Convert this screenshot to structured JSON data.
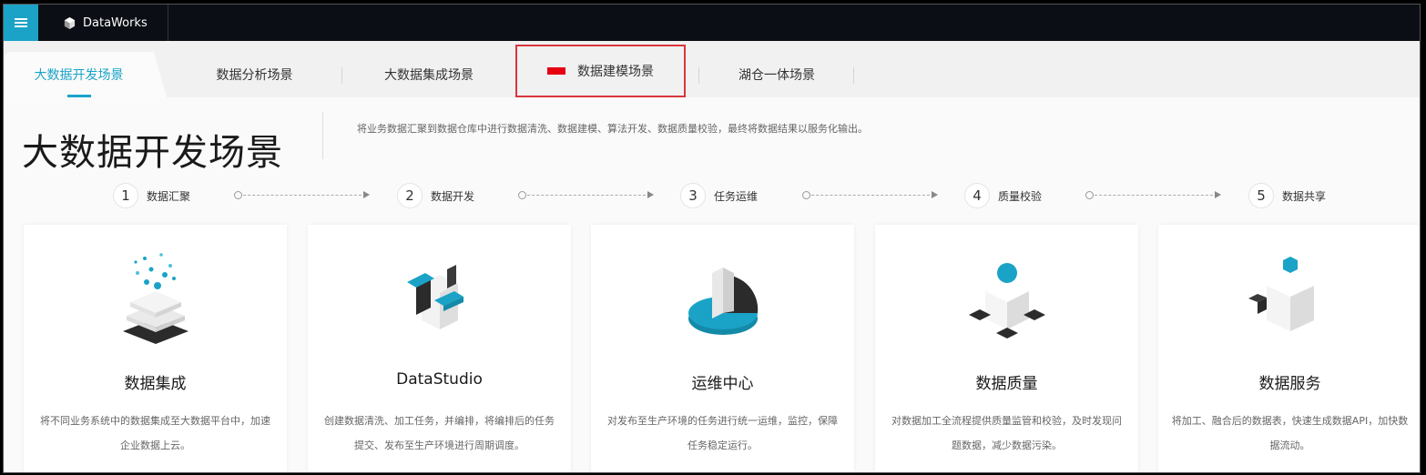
{
  "app": {
    "brand": "DataWorks"
  },
  "tabs": [
    {
      "label": "大数据开发场景",
      "active": true
    },
    {
      "label": "数据分析场景",
      "active": false
    },
    {
      "label": "大数据集成场景",
      "active": false
    },
    {
      "label": "数据建模场景",
      "active": false,
      "highlighted": true
    },
    {
      "label": "湖仓一体场景",
      "active": false
    }
  ],
  "hero": {
    "title": "大数据开发场景",
    "description": "将业务数据汇聚到数据仓库中进行数据清洗、数据建模、算法开发、数据质量校验，最终将数据结果以服务化输出。"
  },
  "steps": [
    {
      "num": "1",
      "label": "数据汇聚"
    },
    {
      "num": "2",
      "label": "数据开发"
    },
    {
      "num": "3",
      "label": "任务运维"
    },
    {
      "num": "4",
      "label": "质量校验"
    },
    {
      "num": "5",
      "label": "数据共享"
    }
  ],
  "cards": [
    {
      "title": "数据集成",
      "desc": "将不同业务系统中的数据集成至大数据平台中，加速企业数据上云。"
    },
    {
      "title": "DataStudio",
      "desc": "创建数据清洗、加工任务，并编排，将编排后的任务提交、发布至生产环境进行周期调度。"
    },
    {
      "title": "运维中心",
      "desc": "对发布至生产环境的任务进行统一运维，监控，保障任务稳定运行。"
    },
    {
      "title": "数据质量",
      "desc": "对数据加工全流程提供质量监管和校验，及时发现问题数据，减少数据污染。"
    },
    {
      "title": "数据服务",
      "desc": "将加工、融合后的数据表，快速生成数据API，加快数据流动。"
    }
  ],
  "colors": {
    "accent": "#1aa3c7",
    "topbar": "#0b0e14",
    "highlight": "#d9363e",
    "flag": "#e60012"
  }
}
